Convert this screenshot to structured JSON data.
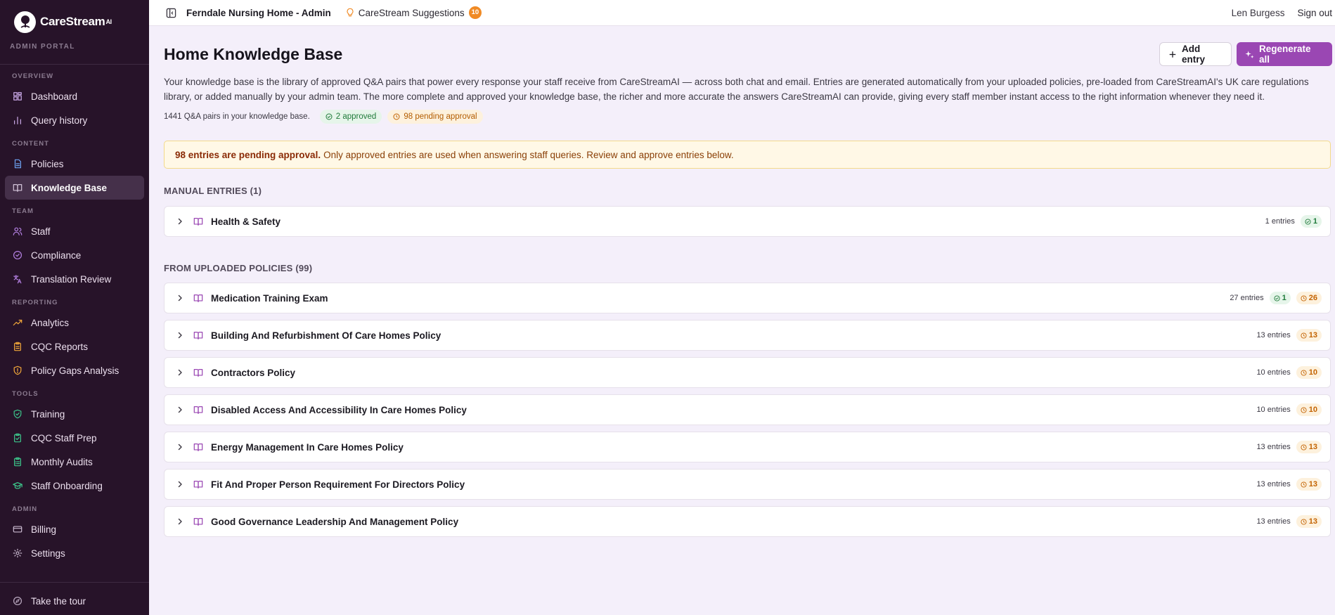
{
  "brand": {
    "name": "CareStream",
    "suffix": "AI",
    "portal": "ADMIN PORTAL"
  },
  "sidebar": {
    "sections": [
      {
        "title": "OVERVIEW",
        "items": [
          {
            "label": "Dashboard",
            "icon": "grid-icon",
            "color": "#c9a8e6"
          },
          {
            "label": "Query history",
            "icon": "bar-chart-icon",
            "color": "#c9a8e6"
          }
        ]
      },
      {
        "title": "CONTENT",
        "items": [
          {
            "label": "Policies",
            "icon": "document-icon",
            "color": "#6ea3f2"
          },
          {
            "label": "Knowledge Base",
            "icon": "book-open-icon",
            "color": "#d2c3d8",
            "active": true
          }
        ]
      },
      {
        "title": "TEAM",
        "items": [
          {
            "label": "Staff",
            "icon": "users-icon",
            "color": "#b27fe0"
          },
          {
            "label": "Compliance",
            "icon": "check-circle-icon",
            "color": "#b27fe0"
          },
          {
            "label": "Translation Review",
            "icon": "translate-icon",
            "color": "#b27fe0"
          }
        ]
      },
      {
        "title": "REPORTING",
        "items": [
          {
            "label": "Analytics",
            "icon": "trending-up-icon",
            "color": "#f0a63a"
          },
          {
            "label": "CQC Reports",
            "icon": "clipboard-icon",
            "color": "#f0a63a"
          },
          {
            "label": "Policy Gaps Analysis",
            "icon": "shield-alert-icon",
            "color": "#f0a63a"
          }
        ]
      },
      {
        "title": "TOOLS",
        "items": [
          {
            "label": "Training",
            "icon": "shield-check-icon",
            "color": "#3cc48a"
          },
          {
            "label": "CQC Staff Prep",
            "icon": "clipboard-check-icon",
            "color": "#3cc48a"
          },
          {
            "label": "Monthly Audits",
            "icon": "clipboard-list-icon",
            "color": "#3cc48a"
          },
          {
            "label": "Staff Onboarding",
            "icon": "graduation-cap-icon",
            "color": "#3cc48a"
          }
        ]
      },
      {
        "title": "ADMIN",
        "items": [
          {
            "label": "Billing",
            "icon": "credit-card-icon",
            "color": "#c9b9cf"
          },
          {
            "label": "Settings",
            "icon": "gear-icon",
            "color": "#c9b9cf"
          }
        ]
      }
    ],
    "tour": {
      "label": "Take the tour",
      "icon": "compass-icon"
    }
  },
  "topbar": {
    "home_name": "Ferndale Nursing Home - Admin",
    "suggestions_label": "CareStream Suggestions",
    "suggestions_count": "10",
    "user": "Len Burgess",
    "sign_out": "Sign out"
  },
  "page": {
    "title": "Home Knowledge Base",
    "add_entry": "Add entry",
    "regenerate_all": "Regenerate all",
    "intro": "Your knowledge base is the library of approved Q&A pairs that power every response your staff receive from CareStreamAI — across both chat and email. Entries are generated automatically from your uploaded policies, pre-loaded from CareStreamAI's UK care regulations library, or added manually by your admin team. The more complete and approved your knowledge base, the richer and more accurate the answers CareStreamAI can provide, giving every staff member instant access to the right information whenever they need it.",
    "pair_count": "1441 Q&A pairs in your knowledge base.",
    "approved_pill": "2 approved",
    "pending_pill": "98 pending approval",
    "alert_strong": "98 entries are pending approval.",
    "alert_text": "Only approved entries are used when answering staff queries. Review and approve entries below."
  },
  "manual": {
    "heading": "MANUAL ENTRIES (1)",
    "rows": [
      {
        "title": "Health & Safety",
        "entries": "1 entries",
        "approved": "1",
        "pending": ""
      }
    ]
  },
  "uploaded": {
    "heading": "FROM UPLOADED POLICIES (99)",
    "rows": [
      {
        "title": "Medication Training Exam",
        "entries": "27 entries",
        "approved": "1",
        "pending": "26"
      },
      {
        "title": "Building And Refurbishment Of Care Homes Policy",
        "entries": "13 entries",
        "approved": "",
        "pending": "13"
      },
      {
        "title": "Contractors Policy",
        "entries": "10 entries",
        "approved": "",
        "pending": "10"
      },
      {
        "title": "Disabled Access And Accessibility In Care Homes Policy",
        "entries": "10 entries",
        "approved": "",
        "pending": "10"
      },
      {
        "title": "Energy Management In Care Homes Policy",
        "entries": "13 entries",
        "approved": "",
        "pending": "13"
      },
      {
        "title": "Fit And Proper Person Requirement For Directors Policy",
        "entries": "13 entries",
        "approved": "",
        "pending": "13"
      },
      {
        "title": "Good Governance Leadership And Management Policy",
        "entries": "13 entries",
        "approved": "",
        "pending": "13"
      }
    ]
  },
  "colors": {
    "sidebar_bg": "#271329",
    "accent": "#9a47b3",
    "pending": "#c36200",
    "approved": "#1f7a3a"
  }
}
